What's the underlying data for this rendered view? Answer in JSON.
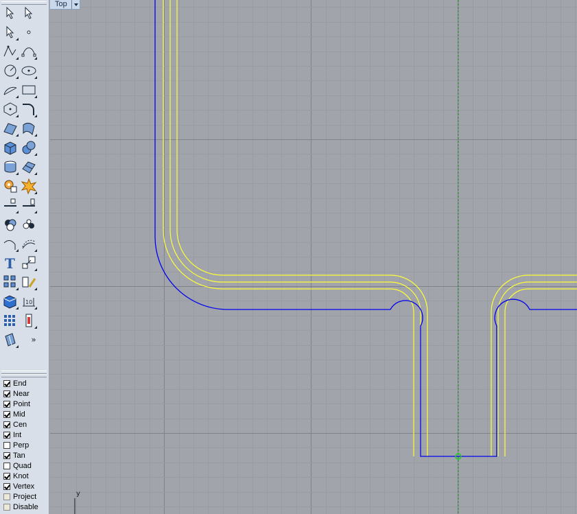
{
  "viewport": {
    "view_name": "Top",
    "axis_label_y": "y",
    "colors": {
      "background": "#a1a5ab",
      "minor_grid": "#999da3",
      "major_grid": "#7f8389",
      "outline_curve": "#0000ee",
      "offset_curves": "#ffff33",
      "y_axis_guide": "#1e8f1e",
      "snap_marker": "#22cc22"
    }
  },
  "toolbar": {
    "tools": [
      "select-points-icon",
      "select-objects-icon",
      "select-point-icon",
      "point-icon",
      "polyline-icon",
      "curve-control-points-icon",
      "circle-icon",
      "ellipse-icon",
      "arc-icon",
      "rectangle-icon",
      "polygon-icon",
      "fillet-curve-icon",
      "surface-from-points-icon",
      "surface-sweep-icon",
      "solid-box-icon",
      "solid-sphere-icon",
      "cylinder-icon",
      "mesh-icon",
      "transform-gear-icon",
      "explode-icon",
      "trim-icon",
      "split-icon",
      "boolean-union-icon",
      "group-icon",
      "curve-tools-icon",
      "rebuild-curve-icon",
      "text-icon",
      "scale-icon",
      "array-icon",
      "edit-tools-icon",
      "render-box-icon",
      "dimension-icon",
      "grid-array-icon",
      "layers-icon",
      "analyze-icon"
    ],
    "more_label": "»"
  },
  "osnap": [
    {
      "label": "End",
      "checked": true,
      "type": "checkbox"
    },
    {
      "label": "Near",
      "checked": true,
      "type": "checkbox"
    },
    {
      "label": "Point",
      "checked": true,
      "type": "checkbox"
    },
    {
      "label": "Mid",
      "checked": true,
      "type": "checkbox"
    },
    {
      "label": "Cen",
      "checked": true,
      "type": "checkbox"
    },
    {
      "label": "Int",
      "checked": true,
      "type": "checkbox"
    },
    {
      "label": "Perp",
      "checked": false,
      "type": "checkbox"
    },
    {
      "label": "Tan",
      "checked": true,
      "type": "checkbox"
    },
    {
      "label": "Quad",
      "checked": false,
      "type": "checkbox"
    },
    {
      "label": "Knot",
      "checked": true,
      "type": "checkbox"
    },
    {
      "label": "Vertex",
      "checked": true,
      "type": "checkbox"
    },
    {
      "label": "Project",
      "checked": false,
      "type": "button"
    },
    {
      "label": "Disable",
      "checked": false,
      "type": "button"
    }
  ]
}
